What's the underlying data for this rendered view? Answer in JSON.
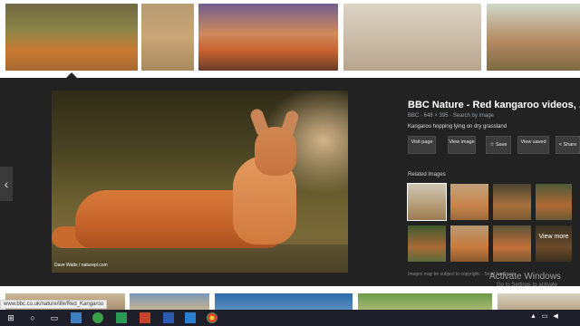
{
  "panel": {
    "title": "BBC Nature - Red kangaroo videos, ...",
    "meta": "BBC · 648 × 395 · Search by image",
    "description": "Kangaroo hopping lying on dry grassland",
    "image_credit": "Dave Watts / naturepl.com",
    "prev_arrow": "‹"
  },
  "buttons": {
    "visit_page": "Visit page",
    "view_image": "View image",
    "save": "☆ Save",
    "view_saved": "View saved",
    "share": "< Share"
  },
  "related": {
    "label": "Related images",
    "view_more": "View more"
  },
  "disclaimer": "Images may be subject to copyright. · Send feedback",
  "status_url": "www.bbc.co.uk/nature/life/Red_Kangaroo",
  "watermark": {
    "line1": "Activate Windows",
    "line2": "Go to Settings to activate Windows."
  },
  "taskbar": {
    "start": "⊞",
    "search": "○",
    "taskview": "▭"
  }
}
